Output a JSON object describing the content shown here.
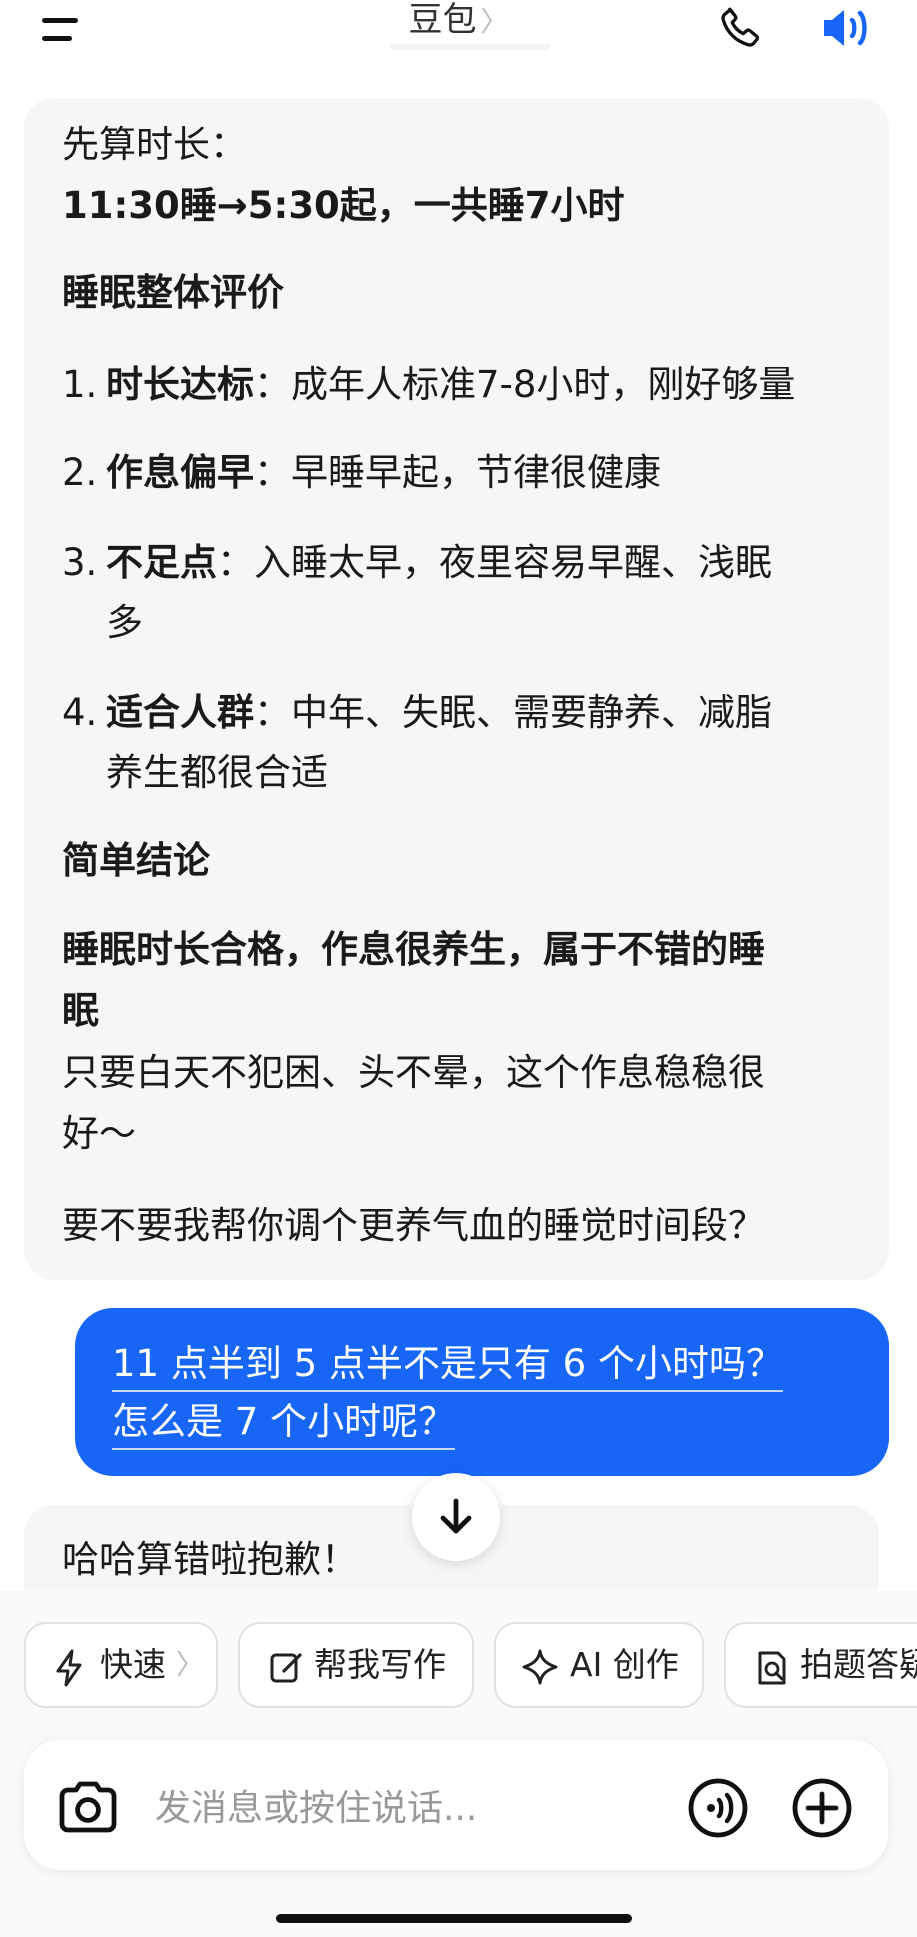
{
  "header": {
    "title": "豆包",
    "title_chevron": "〉"
  },
  "messages": {
    "bot1": {
      "l1": "先算时长：",
      "l2": "11:30睡→5:30起，一共睡7小时",
      "h_eval": "睡眠整体评价",
      "items": [
        {
          "num": "1.",
          "bold": "时长达标",
          "text": "：成年人标准7-8小时，刚好够量"
        },
        {
          "num": "2.",
          "bold": "作息偏早",
          "text": "：早睡早起，节律很健康"
        },
        {
          "num": "3.",
          "bold": "不足点",
          "text": "：入睡太早，夜里容易早醒、浅眠",
          "cont": "多"
        },
        {
          "num": "4.",
          "bold": "适合人群",
          "text": "：中年、失眠、需要静养、减脂",
          "cont": "养生都很合适"
        }
      ],
      "h_conclusion": "简单结论",
      "conclusion_bold_1": "睡眠时长合格，作息很养生，属于不错的睡",
      "conclusion_bold_2": "眠",
      "conclusion_1": "只要白天不犯困、头不晕，这个作息稳稳很",
      "conclusion_2": "好～",
      "ask": "要不要我帮你调个更养气血的睡觉时间段？"
    },
    "user1": {
      "l1": "11 点半到 5 点半不是只有 6 个小时吗？",
      "l2": "怎么是 7 个小时呢？"
    },
    "bot2": {
      "l1": "哈哈算错啦抱歉！"
    }
  },
  "chips": [
    {
      "label": "快速",
      "chevron": "〉",
      "icon": "lightning-icon"
    },
    {
      "label": "帮我写作",
      "icon": "edit-icon"
    },
    {
      "label": "AI 创作",
      "icon": "sparkle-icon"
    },
    {
      "label": "拍题答疑",
      "icon": "scan-doc-icon"
    }
  ],
  "input": {
    "placeholder": "发消息或按住说话..."
  },
  "colors": {
    "accent": "#1766f5",
    "bubble_bg": "#f6f6f7"
  }
}
